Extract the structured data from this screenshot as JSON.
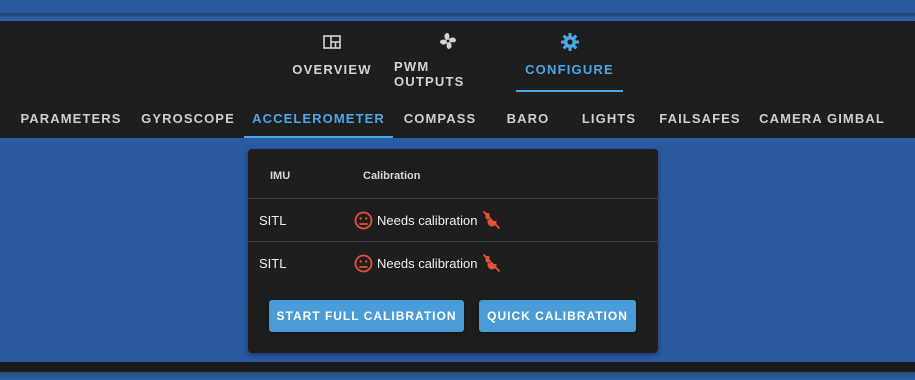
{
  "main_tabs": [
    {
      "label": "OVERVIEW",
      "icon": "grid-icon",
      "active": false
    },
    {
      "label": "PWM OUTPUTS",
      "icon": "fan-icon",
      "active": false
    },
    {
      "label": "CONFIGURE",
      "icon": "gear-icon",
      "active": true
    }
  ],
  "sub_tabs": [
    {
      "label": "PARAMETERS",
      "active": false
    },
    {
      "label": "GYROSCOPE",
      "active": false
    },
    {
      "label": "ACCELEROMETER",
      "active": true
    },
    {
      "label": "COMPASS",
      "active": false
    },
    {
      "label": "BARO",
      "active": false
    },
    {
      "label": "LIGHTS",
      "active": false
    },
    {
      "label": "FAILSAFES",
      "active": false
    },
    {
      "label": "CAMERA GIMBAL",
      "active": false
    }
  ],
  "table": {
    "headers": {
      "imu": "IMU",
      "calibration": "Calibration"
    },
    "rows": [
      {
        "imu": "SITL",
        "status": "Needs calibration",
        "status_icon": "frown-face-icon",
        "extra_icon": "accelerometer-off-icon"
      },
      {
        "imu": "SITL",
        "status": "Needs calibration",
        "status_icon": "frown-face-icon",
        "extra_icon": "accelerometer-off-icon"
      }
    ]
  },
  "buttons": {
    "full_calibration": "START FULL CALIBRATION",
    "quick_calibration": "QUICK CALIBRATION"
  },
  "colors": {
    "accent": "#4aa8e8",
    "button": "#4a9cd6",
    "warning": "#e8503a",
    "background": "#2a5aa0",
    "panel": "#1e1e1e"
  }
}
